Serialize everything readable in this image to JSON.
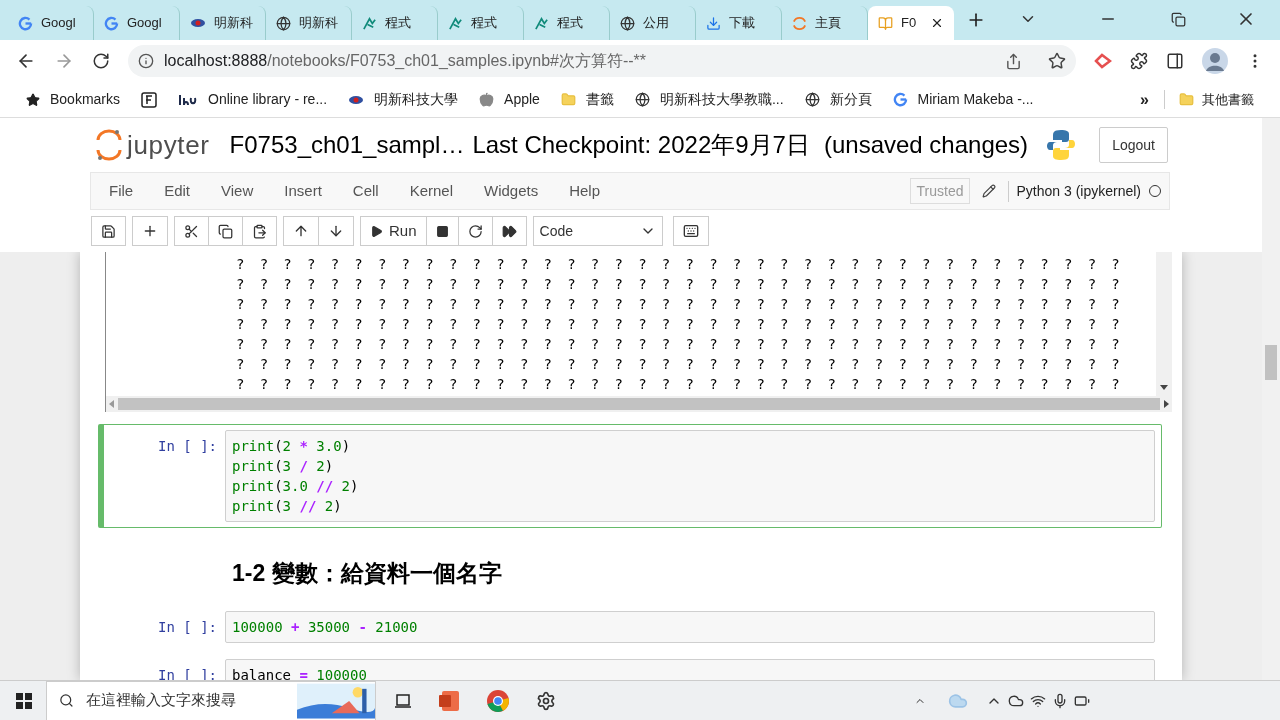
{
  "browser": {
    "tabs": [
      {
        "label": "Googl",
        "kind": "google",
        "selected": false
      },
      {
        "label": "Googl",
        "kind": "google",
        "selected": false
      },
      {
        "label": "明新科",
        "kind": "school",
        "selected": false
      },
      {
        "label": "明新科",
        "kind": "globe",
        "selected": false
      },
      {
        "label": "程式",
        "kind": "code",
        "selected": false
      },
      {
        "label": "程式",
        "kind": "code",
        "selected": false
      },
      {
        "label": "程式",
        "kind": "code",
        "selected": false
      },
      {
        "label": "公用",
        "kind": "globe",
        "selected": false
      },
      {
        "label": "下載",
        "kind": "download",
        "selected": false
      },
      {
        "label": "主頁",
        "kind": "ring",
        "selected": false
      },
      {
        "label": "F0",
        "kind": "book",
        "selected": true
      }
    ],
    "url_host": "localhost:8888",
    "url_path": "/notebooks/F0753_ch01_samples.ipynb#次方算符--**",
    "bookmarks": [
      {
        "label": "Bookmarks",
        "kind": "star"
      },
      {
        "kind": "box"
      },
      {
        "label": "Online library - re...",
        "kind": "lib"
      },
      {
        "label": "明新科技大學",
        "kind": "school"
      },
      {
        "label": "Apple",
        "kind": "apple"
      },
      {
        "label": "書籤",
        "kind": "folder"
      },
      {
        "label": "明新科技大學教職...",
        "kind": "globe"
      },
      {
        "label": "新分頁",
        "kind": "globe"
      },
      {
        "label": "Miriam Makeba -...",
        "kind": "google"
      }
    ],
    "more": "»",
    "other": "其他書籤"
  },
  "jupyter": {
    "logo": "jupyter",
    "notebook_name": "F0753_ch01_sampl…",
    "checkpoint": "Last Checkpoint: 2022年9月7日",
    "save_status": "(unsaved changes)",
    "logout": "Logout",
    "menu": [
      "File",
      "Edit",
      "View",
      "Insert",
      "Cell",
      "Kernel",
      "Widgets",
      "Help"
    ],
    "trusted": "Trusted",
    "kernel": "Python 3 (ipykernel)",
    "kernel_busy": false,
    "run_label": "Run",
    "cell_type": "Code"
  },
  "output_rows": [
    "? ? ? ? ? ? ? ? ? ? ? ? ? ? ? ? ? ? ? ? ? ? ? ? ? ? ? ? ? ? ? ? ? ? ? ? ? ?",
    "? ? ? ? ? ? ? ? ? ? ? ? ? ? ? ? ? ? ? ? ? ? ? ? ? ? ? ? ? ? ? ? ? ? ? ? ? ?",
    "? ? ? ? ? ? ? ? ? ? ? ? ? ? ? ? ? ? ? ? ? ? ? ? ? ? ? ? ? ? ? ? ? ? ? ? ? ?",
    "? ? ? ? ? ? ? ? ? ? ? ? ? ? ? ? ? ? ? ? ? ? ? ? ? ? ? ? ? ? ? ? ? ? ? ? ? ?",
    "? ? ? ? ? ? ? ? ? ? ? ? ? ? ? ? ? ? ? ? ? ? ? ? ? ? ? ? ? ? ? ? ? ? ? ? ? ?",
    "? ? ? ? ? ? ? ? ? ? ? ? ? ? ? ? ? ? ? ? ? ? ? ? ? ? ? ? ? ? ? ? ? ? ? ? ? ?",
    "? ? ? ? ? ? ? ? ? ? ? ? ? ? ? ? ? ? ? ? ? ? ? ? ? ? ? ? ? ? ? ? ? ? ? ? ? ?"
  ],
  "cells": [
    {
      "kind": "code",
      "prompt": "In [ ]:",
      "selected": true,
      "lines": [
        [
          {
            "text": "print",
            "kind": "builtin"
          },
          {
            "text": "(",
            "kind": "plain"
          },
          {
            "text": "2",
            "kind": "num"
          },
          {
            "text": " * ",
            "kind": "op"
          },
          {
            "text": "3.0",
            "kind": "num"
          },
          {
            "text": ")",
            "kind": "plain"
          }
        ],
        [
          {
            "text": "print",
            "kind": "builtin"
          },
          {
            "text": "(",
            "kind": "plain"
          },
          {
            "text": "3",
            "kind": "num"
          },
          {
            "text": " / ",
            "kind": "op"
          },
          {
            "text": "2",
            "kind": "num"
          },
          {
            "text": ")",
            "kind": "plain"
          }
        ],
        [
          {
            "text": "print",
            "kind": "builtin"
          },
          {
            "text": "(",
            "kind": "plain"
          },
          {
            "text": "3.0",
            "kind": "num"
          },
          {
            "text": " // ",
            "kind": "op"
          },
          {
            "text": "2",
            "kind": "num"
          },
          {
            "text": ")",
            "kind": "plain"
          }
        ],
        [
          {
            "text": "print",
            "kind": "builtin"
          },
          {
            "text": "(",
            "kind": "plain"
          },
          {
            "text": "3",
            "kind": "num"
          },
          {
            "text": " // ",
            "kind": "op"
          },
          {
            "text": "2",
            "kind": "num"
          },
          {
            "text": ")",
            "kind": "plain"
          }
        ]
      ]
    },
    {
      "kind": "heading",
      "text": "1-2 變數：給資料一個名字"
    },
    {
      "kind": "code",
      "prompt": "In [ ]:",
      "selected": false,
      "lines": [
        [
          {
            "text": "100000",
            "kind": "num"
          },
          {
            "text": " + ",
            "kind": "op"
          },
          {
            "text": "35000",
            "kind": "num"
          },
          {
            "text": " - ",
            "kind": "op"
          },
          {
            "text": "21000",
            "kind": "num"
          }
        ]
      ]
    },
    {
      "kind": "code",
      "prompt": "In [ ]:",
      "selected": false,
      "lines": [
        [
          {
            "text": "balance",
            "kind": "plain"
          },
          {
            "text": " = ",
            "kind": "op"
          },
          {
            "text": "100000",
            "kind": "num"
          }
        ]
      ]
    }
  ],
  "taskbar": {
    "search_placeholder": "在這裡輸入文字來搜尋"
  }
}
